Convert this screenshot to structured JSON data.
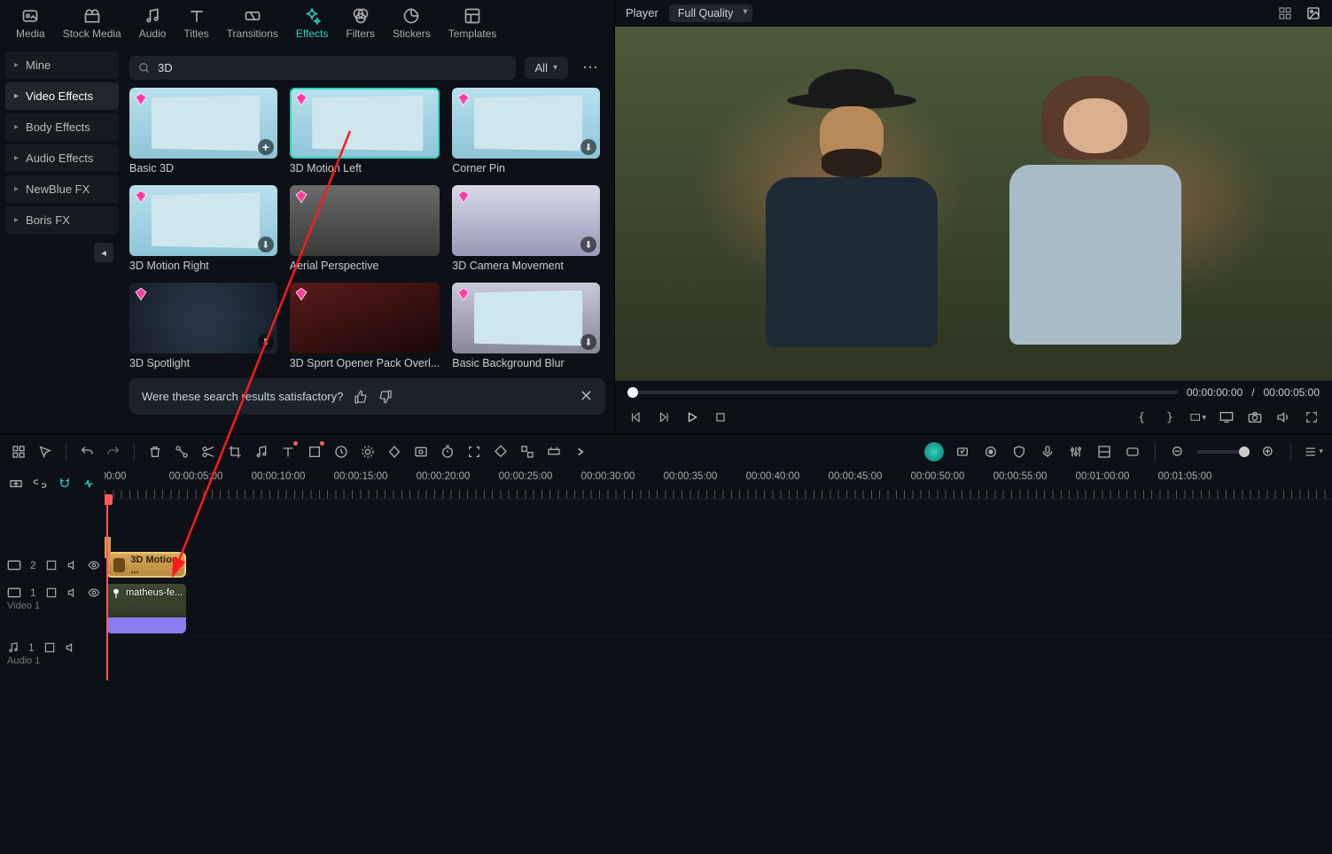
{
  "topTabs": [
    {
      "id": "media",
      "label": "Media"
    },
    {
      "id": "stock",
      "label": "Stock Media"
    },
    {
      "id": "audio",
      "label": "Audio"
    },
    {
      "id": "titles",
      "label": "Titles"
    },
    {
      "id": "transitions",
      "label": "Transitions"
    },
    {
      "id": "effects",
      "label": "Effects",
      "active": true
    },
    {
      "id": "filters",
      "label": "Filters"
    },
    {
      "id": "stickers",
      "label": "Stickers"
    },
    {
      "id": "templates",
      "label": "Templates"
    }
  ],
  "sidebar": [
    {
      "label": "Mine"
    },
    {
      "label": "Video Effects",
      "active": true
    },
    {
      "label": "Body Effects"
    },
    {
      "label": "Audio Effects"
    },
    {
      "label": "NewBlue FX"
    },
    {
      "label": "Boris FX"
    }
  ],
  "search": {
    "query": "3D",
    "placeholder": ""
  },
  "filter": {
    "label": "All"
  },
  "effects": [
    {
      "label": "Basic 3D",
      "gem": true,
      "add": true
    },
    {
      "label": "3D Motion Left",
      "gem": true,
      "selected": true
    },
    {
      "label": "Corner Pin",
      "gem": true,
      "dl": true
    },
    {
      "label": "3D Motion Right",
      "gem": true,
      "dl": true
    },
    {
      "label": "Aerial Perspective",
      "gem": true
    },
    {
      "label": "3D Camera Movement",
      "gem": true,
      "dl": true
    },
    {
      "label": "3D Spotlight",
      "gem": true,
      "dl": true,
      "dark": true
    },
    {
      "label": "3D Sport Opener Pack Overl...",
      "gem": true,
      "dark2": true
    },
    {
      "label": "Basic Background Blur",
      "gem": true,
      "dl": true
    }
  ],
  "feedback": {
    "text": "Were these search results satisfactory?"
  },
  "player": {
    "tabLabel": "Player",
    "quality": "Full Quality",
    "currentTime": "00:00:00:00",
    "separator": "/",
    "duration": "00:00:05:00"
  },
  "ruler": {
    "labels": [
      "00:00",
      "00:00:05:00",
      "00:00:10:00",
      "00:00:15:00",
      "00:00:20:00",
      "00:00:25:00",
      "00:00:30:00",
      "00:00:35:00",
      "00:00:40:00",
      "00:00:45:00",
      "00:00:50:00",
      "00:00:55:00",
      "00:01:00:00",
      "00:01:05:00"
    ]
  },
  "tracks": {
    "fxTrack": {
      "badge": "2"
    },
    "videoTrack": {
      "badge": "1",
      "name": "Video 1"
    },
    "audioTrack": {
      "badge": "1",
      "name": "Audio 1"
    }
  },
  "clips": {
    "fx": {
      "label": "3D Motion ..."
    },
    "video": {
      "label": "matheus-fe..."
    }
  }
}
